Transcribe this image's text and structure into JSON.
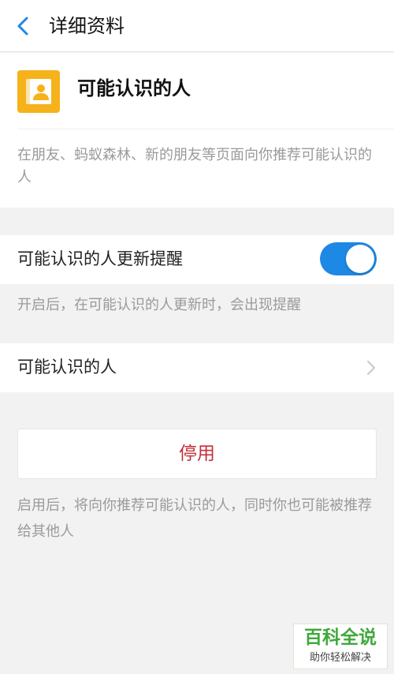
{
  "header": {
    "title": "详细资料",
    "back_icon": "chevron-left-icon"
  },
  "app": {
    "icon": "contacts-book-icon",
    "name": "可能认识的人",
    "description": "在朋友、蚂蚁森林、新的朋友等页面向你推荐可能认识的人"
  },
  "remind": {
    "label": "可能认识的人更新提醒",
    "toggle_on": true,
    "note": "开启后，在可能认识的人更新时，会出现提醒"
  },
  "people": {
    "label": "可能认识的人",
    "chevron": "chevron-right-icon"
  },
  "disable": {
    "label": "停用",
    "note": "启用后，将向你推荐可能认识的人，同时你也可能被推荐给其他人"
  },
  "watermark": {
    "main": "百科全说",
    "sub": "助你轻松解决"
  },
  "colors": {
    "accent": "#1e88e5",
    "icon_bg": "#f6b21b",
    "danger": "#c4303a",
    "watermark": "#3fa83b"
  }
}
